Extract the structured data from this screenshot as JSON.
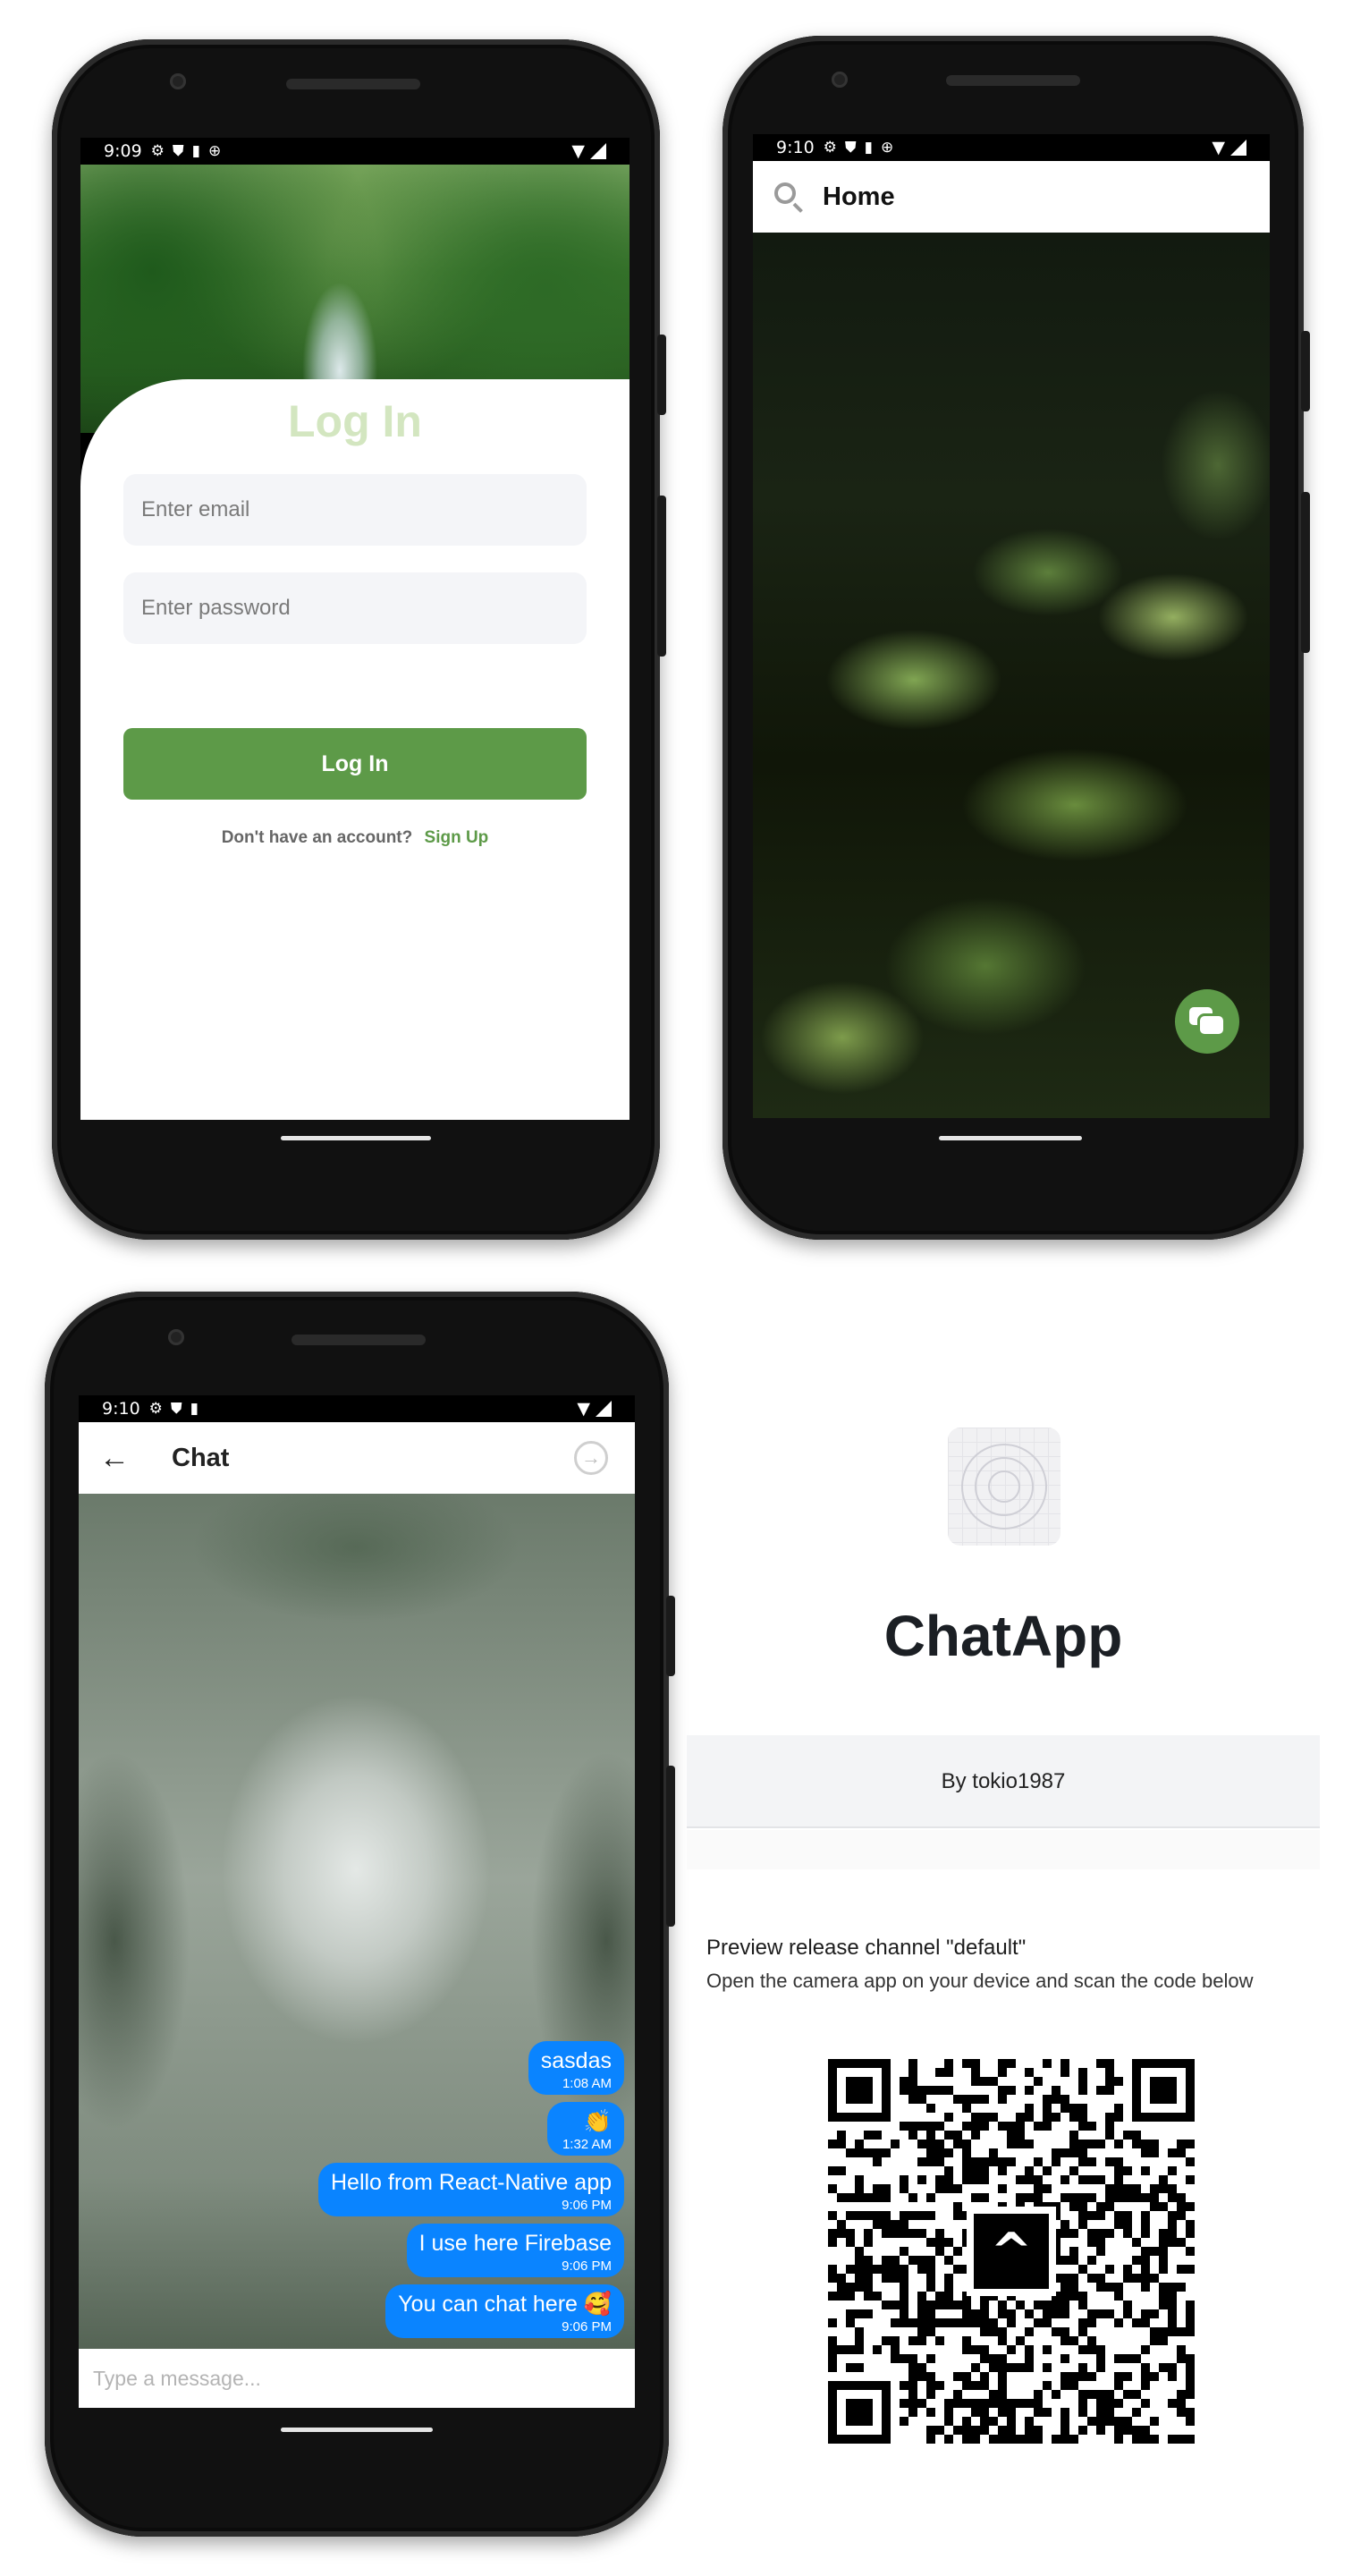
{
  "login_phone": {
    "status": {
      "time": "9:09"
    },
    "title": "Log In",
    "email_placeholder": "Enter email",
    "password_placeholder": "Enter password",
    "login_button": "Log In",
    "signup_prompt": "Don't have an account?",
    "signup_link": "Sign Up",
    "colors": {
      "accent": "#5d9a48",
      "title": "#d3e6c0"
    }
  },
  "home_phone": {
    "status": {
      "time": "9:10"
    },
    "title": "Home",
    "fab_icon": "chat-icon"
  },
  "chat_phone": {
    "status": {
      "time": "9:10"
    },
    "title": "Chat",
    "input_placeholder": "Type a message...",
    "messages": [
      {
        "text": "sasdas",
        "time": "1:08 AM"
      },
      {
        "text": "👏",
        "time": "1:32 AM"
      },
      {
        "text": "Hello from React-Native app",
        "time": "9:06 PM"
      },
      {
        "text": "I use here Firebase",
        "time": "9:06 PM"
      },
      {
        "text": "You can chat here 🥰",
        "time": "9:06 PM"
      }
    ],
    "colors": {
      "bubble": "#0a84ff"
    }
  },
  "expo_preview": {
    "app_name": "ChatApp",
    "author": "By tokio1987",
    "channel_text": "Preview release channel \"default\"",
    "instructions": "Open the camera app on your device and scan the code below"
  }
}
